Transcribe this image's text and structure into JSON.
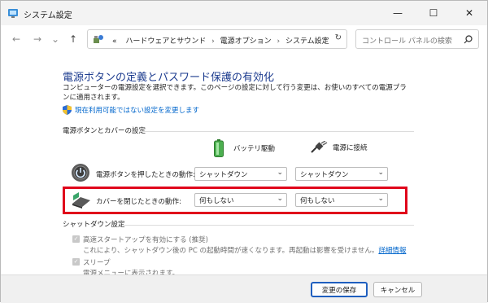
{
  "window": {
    "title": "システム設定",
    "controls": {
      "minimize": "—",
      "maximize": "☐",
      "close": "✕"
    }
  },
  "nav": {
    "back": "←",
    "forward": "→",
    "recent": "⌄",
    "up": "↑",
    "overflow": "«",
    "breadcrumbs": [
      "ハードウェアとサウンド",
      "電源オプション",
      "システム設定"
    ],
    "dropdown": "⌄",
    "refresh": "↻",
    "search_placeholder": "コントロール パネルの検索"
  },
  "content": {
    "heading": "電源ボタンの定義とパスワード保護の有効化",
    "description": "コンピューターの電源設定を選択できます。このページの設定に対して行う変更は、お使いのすべての電源プランに適用されます。",
    "change_link": "現在利用可能ではない設定を変更します",
    "buttons_section": "電源ボタンとカバーの設定",
    "col_battery": "バッテリ駆動",
    "col_plugged": "電源に接続",
    "rows": [
      {
        "label": "電源ボタンを押したときの動作:",
        "battery": "シャットダウン",
        "plugged": "シャットダウン"
      },
      {
        "label": "カバーを閉じたときの動作:",
        "battery": "何もしない",
        "plugged": "何もしない"
      }
    ],
    "shutdown_section": "シャットダウン設定",
    "fast_startup_label": "高速スタートアップを有効にする (推奨)",
    "fast_startup_desc": "これにより、シャットダウン後の PC の起動時間が速くなります。再起動は影響を受けません。",
    "details_link": "詳細情報",
    "sleep_label": "スリープ",
    "sleep_desc": "電源メニューに表示されます。"
  },
  "footer": {
    "save": "変更の保存",
    "cancel": "キャンセル"
  }
}
